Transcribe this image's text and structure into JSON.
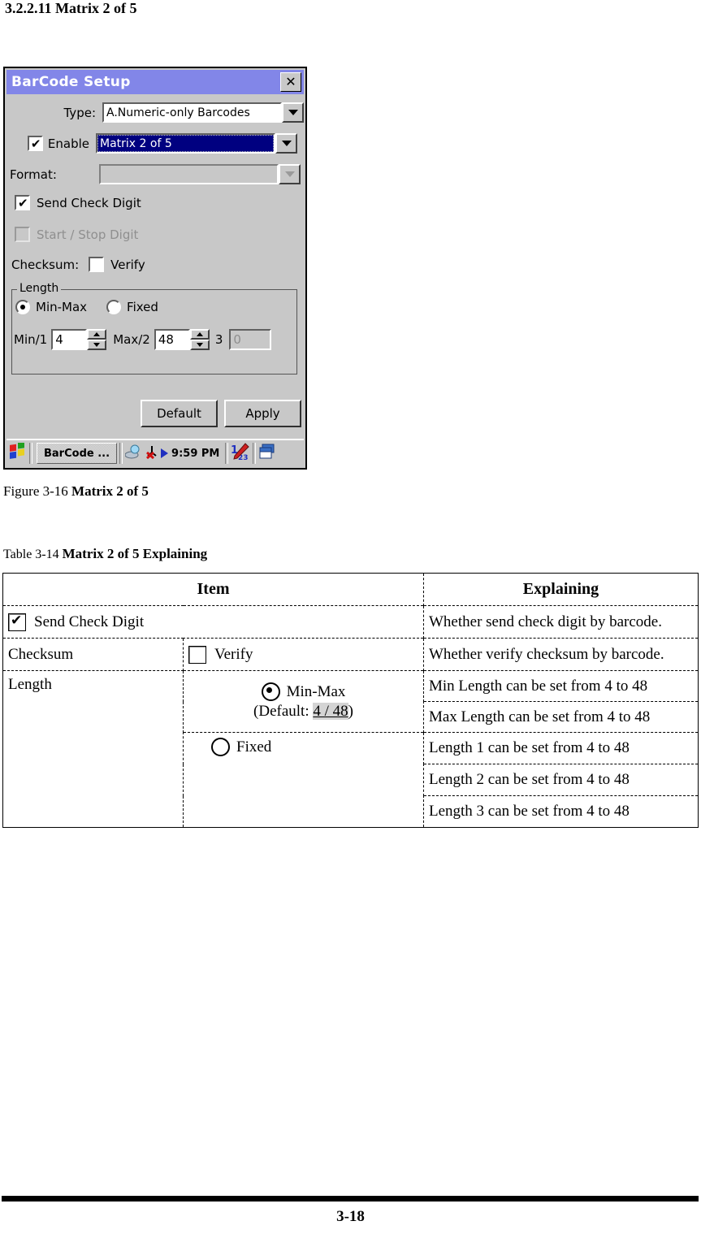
{
  "page": {
    "heading": "3.2.2.11 Matrix 2 of 5",
    "figure_caption_prefix": "Figure 3-16 ",
    "figure_caption_title": "Matrix 2 of 5",
    "table_caption_prefix": "Table 3-14 ",
    "table_caption_title": "Matrix 2 of 5 Explaining",
    "footer_page_number": "3-18"
  },
  "dialog": {
    "title": "BarCode Setup",
    "close_label": "✕",
    "type_label": "Type:",
    "type_value": "A.Numeric-only Barcodes",
    "enable_label": "Enable",
    "enable_checked": true,
    "enable_value": "Matrix 2 of 5",
    "format_label": "Format:",
    "format_value": "",
    "send_check_digit_label": "Send Check Digit",
    "send_check_digit_checked": true,
    "start_stop_digit_label": "Start / Stop Digit",
    "start_stop_digit_checked": false,
    "checksum_label": "Checksum:",
    "verify_label": "Verify",
    "verify_checked": false,
    "length_group_label": "Length",
    "minmax_label": "Min-Max",
    "minmax_selected": true,
    "fixed_label": "Fixed",
    "fixed_selected": false,
    "min1_label": "Min/1",
    "min1_value": "4",
    "max2_label": "Max/2",
    "max2_value": "48",
    "third_label": "3",
    "third_value": "0",
    "default_button": "Default",
    "apply_button": "Apply",
    "taskbar": {
      "task_label": "BarCode ...",
      "time": "9:59 PM"
    }
  },
  "table": {
    "headers": [
      "Item",
      "Explaining"
    ],
    "rows": {
      "send_check_digit": {
        "item": "Send Check Digit",
        "checked": true,
        "explaining": "Whether send check digit by barcode."
      },
      "checksum": {
        "item": "Checksum",
        "verify": "Verify",
        "checked": false,
        "explaining": "Whether verify checksum by barcode."
      },
      "length": {
        "item": "Length",
        "minmax": "Min-Max",
        "minmax_selected": true,
        "default_prefix": "(Default: ",
        "default_value": "4 / 48",
        "default_suffix": ")",
        "fixed": "Fixed",
        "fixed_selected": false,
        "explain_min": "Min Length can be set from 4 to 48",
        "explain_max": "Max Length can be set from 4 to 48",
        "explain_len1": "Length 1 can be set from 4 to 48",
        "explain_len2": "Length 2 can be set from 4 to 48",
        "explain_len3": "Length 3 can be set from 4 to 48"
      }
    }
  }
}
